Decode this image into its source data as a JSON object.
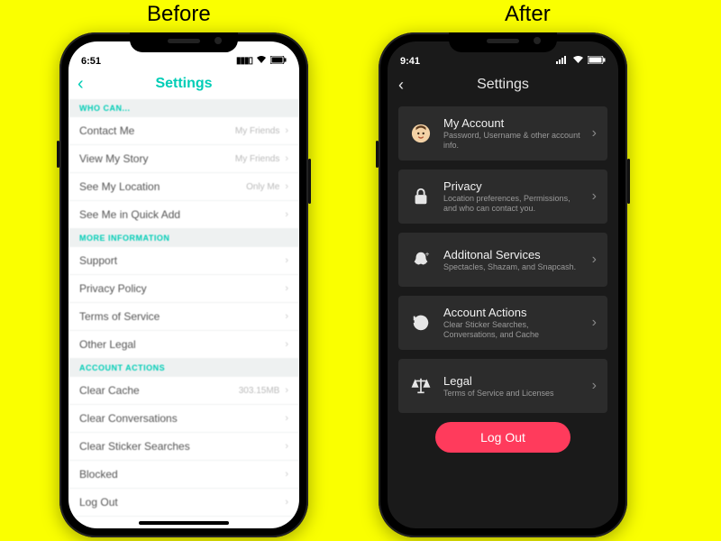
{
  "headers": {
    "before": "Before",
    "after": "After"
  },
  "status": {
    "light_time": "6:51",
    "dark_time": "9:41",
    "signal": "▮▮▮▯",
    "wifi": "▲",
    "battery": "▮▮▮"
  },
  "light": {
    "title": "Settings",
    "sections": {
      "who_can": {
        "header": "WHO CAN...",
        "rows": [
          {
            "label": "Contact Me",
            "value": "My Friends"
          },
          {
            "label": "View My Story",
            "value": "My Friends"
          },
          {
            "label": "See My Location",
            "value": "Only Me"
          },
          {
            "label": "See Me in Quick Add",
            "value": ""
          }
        ]
      },
      "more_info": {
        "header": "MORE INFORMATION",
        "rows": [
          {
            "label": "Support"
          },
          {
            "label": "Privacy Policy"
          },
          {
            "label": "Terms of Service"
          },
          {
            "label": "Other Legal"
          }
        ]
      },
      "account_actions": {
        "header": "ACCOUNT ACTIONS",
        "rows": [
          {
            "label": "Clear Cache",
            "value": "303.15MB"
          },
          {
            "label": "Clear Conversations"
          },
          {
            "label": "Clear Sticker Searches"
          },
          {
            "label": "Blocked"
          },
          {
            "label": "Log Out"
          }
        ]
      }
    }
  },
  "dark": {
    "title": "Settings",
    "items": [
      {
        "icon": "avatar-icon",
        "title": "My Account",
        "subtitle": "Password, Username & other account info."
      },
      {
        "icon": "lock-icon",
        "title": "Privacy",
        "subtitle": "Location preferences, Permissions, and who can contact you."
      },
      {
        "icon": "ghost-plus-icon",
        "title": "Additonal Services",
        "subtitle": "Spectacles, Shazam, and Snapcash."
      },
      {
        "icon": "history-icon",
        "title": "Account Actions",
        "subtitle": "Clear Sticker Searches, Conversations, and Cache"
      },
      {
        "icon": "scales-icon",
        "title": "Legal",
        "subtitle": "Terms of Service and Licenses"
      }
    ],
    "logout": "Log Out"
  }
}
